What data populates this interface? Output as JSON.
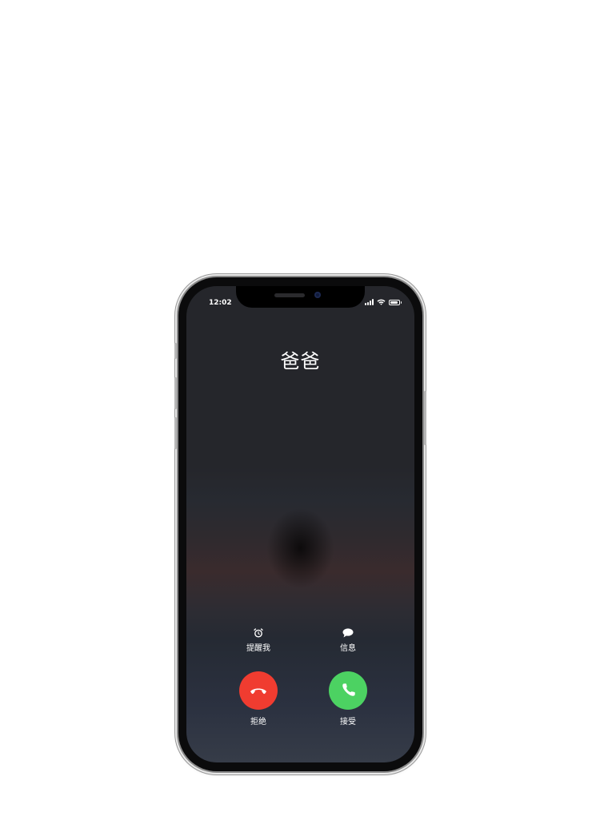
{
  "status_bar": {
    "time": "12:02",
    "battery_level": 0.85,
    "signal_bars": 4
  },
  "call": {
    "caller_name": "爸爸"
  },
  "quick_actions": {
    "remind_label": "提醒我",
    "remind_icon": "alarm-clock-icon",
    "message_label": "信息",
    "message_icon": "speech-bubble-icon"
  },
  "call_buttons": {
    "decline_label": "拒绝",
    "decline_color": "#f03c30",
    "decline_icon": "phone-hangup-icon",
    "accept_label": "接受",
    "accept_color": "#4cd262",
    "accept_icon": "phone-icon"
  }
}
